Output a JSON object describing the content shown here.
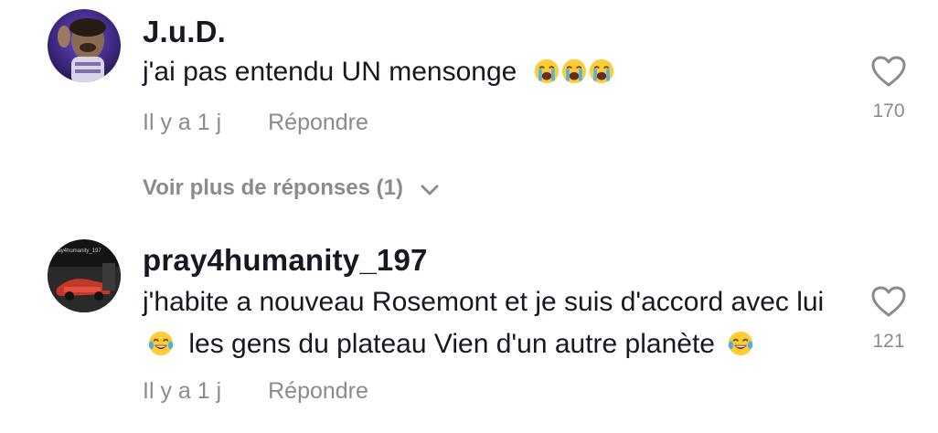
{
  "comments": [
    {
      "username": "J.u.D.",
      "text": "j'ai pas entendu UN mensonge",
      "emoji": [
        "loudly-crying-face",
        "loudly-crying-face",
        "loudly-crying-face"
      ],
      "time": "Il y a 1 j",
      "reply_label": "Répondre",
      "likes": "170"
    },
    {
      "username": "pray4humanity_197",
      "text_part1": "j'habite a nouveau Rosemont et je suis d'accord avec lui",
      "text_part2": "les gens du plateau Vien d'un autre planète",
      "emoji": [
        "face-with-tears-of-joy",
        "face-with-tears-of-joy"
      ],
      "time": "Il y a 1 j",
      "reply_label": "Répondre",
      "likes": "121"
    }
  ],
  "view_more_replies": "Voir plus de réponses (1)",
  "avatar_text": "pray4humanity_197",
  "colors": {
    "text": "#161823",
    "muted": "#8a8b91",
    "background": "#ffffff"
  },
  "icons": {
    "like": "heart-outline-icon",
    "expand": "chevron-down-icon"
  }
}
